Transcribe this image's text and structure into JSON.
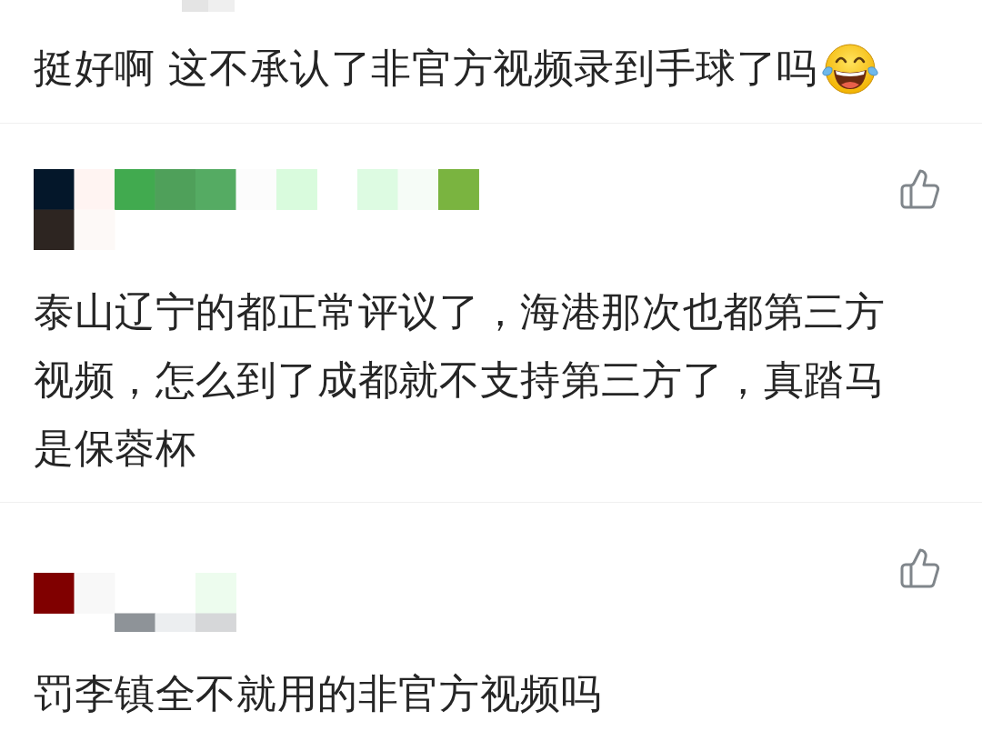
{
  "comments": [
    {
      "kind": "cut_top",
      "text": "挺好啊 这不承认了非官方视频录到手球了吗",
      "trailing_emoji": true
    },
    {
      "kind": "full",
      "liked": false,
      "text": "泰山辽宁的都正常评议了，海港那次也都第三方视频，怎么到了成都就不支持第三方了，真踏马是保蓉杯"
    },
    {
      "kind": "full",
      "liked": false,
      "text": "罚李镇全不就用的非官方视频吗"
    }
  ]
}
